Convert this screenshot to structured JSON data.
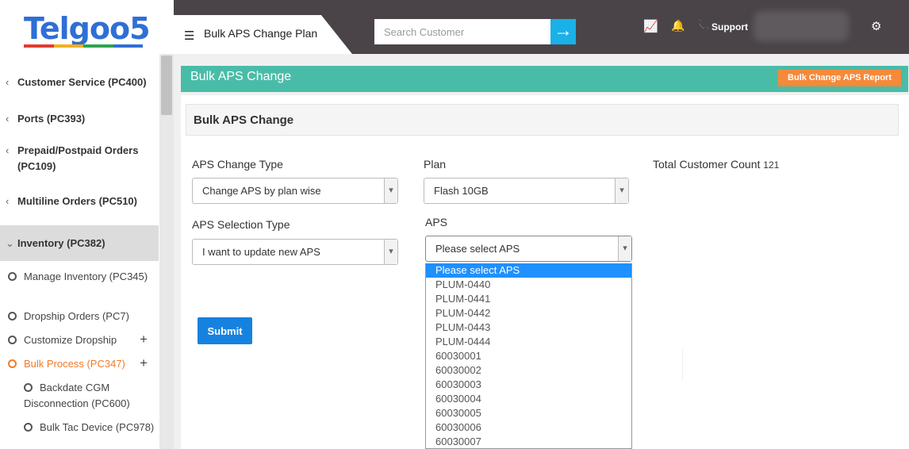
{
  "brand": {
    "logo_text": "Telgoo5",
    "colors": [
      "#e23b2e",
      "#f2b01e",
      "#2ea44f",
      "#2f6fd6"
    ]
  },
  "sidebar": {
    "items": [
      {
        "label": "Customer Service (PC400)"
      },
      {
        "label": "Ports (PC393)"
      },
      {
        "label": "Prepaid/Postpaid Orders (PC109)"
      },
      {
        "label": "Multiline Orders (PC510)"
      },
      {
        "label": "Inventory (PC382)"
      }
    ],
    "sub_items": [
      {
        "label": "Manage Inventory (PC345)"
      },
      {
        "label": "Dropship Orders (PC7)"
      },
      {
        "label": "Customize Dropship"
      },
      {
        "label": "Bulk Process (PC347)"
      }
    ],
    "sub_sub_items": [
      {
        "label": "Backdate CGM Disconnection (PC600)"
      },
      {
        "label": "Bulk Tac Device (PC978)"
      }
    ]
  },
  "header": {
    "page_title": "Bulk APS Change Plan",
    "search_placeholder": "Search Customer",
    "support_label": "Support"
  },
  "main": {
    "banner_title": "Bulk APS Change",
    "report_button": "Bulk Change APS Report",
    "section_title": "Bulk APS Change",
    "aps_change_type": {
      "label": "APS Change Type",
      "value": "Change APS by plan wise"
    },
    "aps_selection_type": {
      "label": "APS Selection Type",
      "value": "I want to update new APS"
    },
    "plan": {
      "label": "Plan",
      "value": "Flash 10GB"
    },
    "aps": {
      "label": "APS",
      "value": "Please select APS",
      "options": [
        "Please select APS",
        "PLUM-0440",
        "PLUM-0441",
        "PLUM-0442",
        "PLUM-0443",
        "PLUM-0444",
        "60030001",
        "60030002",
        "60030003",
        "60030004",
        "60030005",
        "60030006",
        "60030007"
      ]
    },
    "total_customer": {
      "label": "Total Customer Count",
      "value": "121"
    },
    "submit_label": "Submit"
  },
  "colors": {
    "header_bg": "#4a4449",
    "banner": "#49bca8",
    "accent_orange": "#f6893a",
    "primary_blue": "#1682e0",
    "search_button": "#1ab0e8"
  }
}
